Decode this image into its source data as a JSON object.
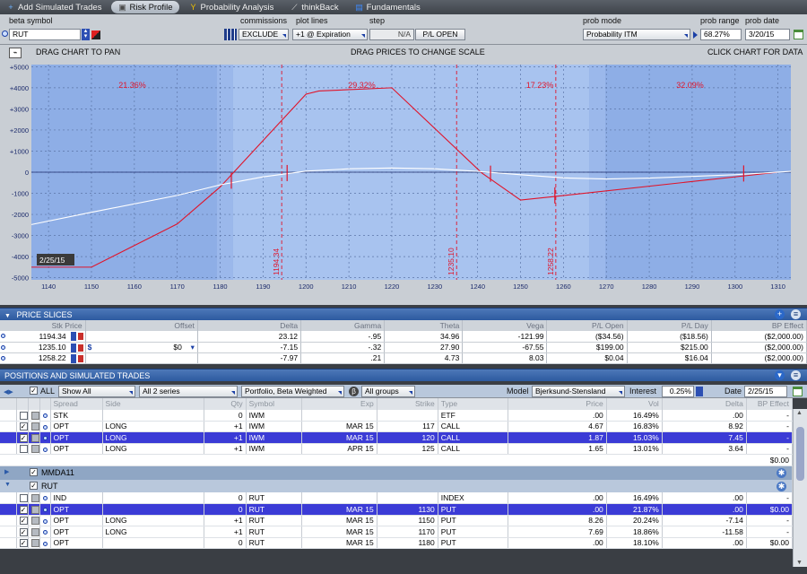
{
  "tabs": [
    {
      "label": "Add Simulated Trades",
      "icon": "plus-icon"
    },
    {
      "label": "Risk Profile",
      "icon": "graph-icon"
    },
    {
      "label": "Probability Analysis",
      "icon": "y-icon"
    },
    {
      "label": "thinkBack",
      "icon": "swoosh-icon"
    },
    {
      "label": "Fundamentals",
      "icon": "folder-icon"
    }
  ],
  "controls": {
    "beta_symbol_label": "beta symbol",
    "symbol": "RUT",
    "commissions_label": "commissions",
    "commissions_value": "EXCLUDE",
    "plot_lines_label": "plot lines",
    "plot_lines_value": "+1 @ Expiration",
    "step_label": "step",
    "step_value": "N/A",
    "pl_mode": "P/L OPEN",
    "prob_mode_label": "prob mode",
    "prob_mode_value": "Probability ITM",
    "prob_range_label": "prob range",
    "prob_range_value": "68.27%",
    "prob_date_label": "prob date",
    "prob_date_value": "3/20/15"
  },
  "chart_hints": {
    "pan": "DRAG CHART TO PAN",
    "scale": "DRAG PRICES TO CHANGE SCALE",
    "data": "CLICK CHART FOR DATA"
  },
  "chart_data": {
    "type": "line",
    "xlim": [
      1136,
      1313
    ],
    "ylim": [
      -5100,
      5100
    ],
    "x_ticks": [
      1140,
      1150,
      1160,
      1170,
      1180,
      1190,
      1200,
      1210,
      1220,
      1230,
      1240,
      1250,
      1260,
      1270,
      1280,
      1290,
      1300,
      1310
    ],
    "y_ticks": [
      -5000,
      -4000,
      -3000,
      -2000,
      -1000,
      0,
      1000,
      2000,
      3000,
      4000,
      5000
    ],
    "y_tick_labels": [
      "-5000",
      "-4000",
      "-3000",
      "-2000",
      "-1000",
      "0",
      "+1000",
      "+2000",
      "+3000",
      "+4000",
      "+5000"
    ],
    "probability_bands": [
      {
        "from": 1136,
        "to": 1183,
        "label": "21.36%"
      },
      {
        "from": 1183,
        "to": 1243,
        "label": "29.32%"
      },
      {
        "from": 1243,
        "to": 1266,
        "label": "17.23%"
      },
      {
        "from": 1266,
        "to": 1313,
        "label": "32.09%"
      }
    ],
    "band_edges": [
      1183,
      1266
    ],
    "vlines": [
      {
        "x": 1194.34,
        "label": "1194.34"
      },
      {
        "x": 1235.1,
        "label": "1235.10"
      },
      {
        "x": 1258.22,
        "label": "1258.22"
      }
    ],
    "series": [
      {
        "name": "expiration",
        "color": "#e0142a",
        "x": [
          1136,
          1150,
          1170,
          1180,
          1200,
          1203,
          1220,
          1241,
          1250,
          1258,
          1310
        ],
        "y": [
          -4500,
          -4500,
          -2450,
          -700,
          3700,
          3850,
          4000,
          -40,
          -1320,
          -1150,
          0
        ]
      },
      {
        "name": "today",
        "color": "#ffffff",
        "x": [
          1136,
          1150,
          1170,
          1180,
          1190,
          1200,
          1210,
          1220,
          1230,
          1240,
          1250,
          1260,
          1270,
          1280,
          1290,
          1300,
          1313
        ],
        "y": [
          -2480,
          -1900,
          -1100,
          -600,
          -220,
          50,
          160,
          200,
          160,
          40,
          -120,
          -270,
          -320,
          -280,
          -200,
          -120,
          40
        ]
      }
    ],
    "date_marker_label": "2/25/15"
  },
  "price_slices": {
    "title": "PRICE SLICES",
    "columns": [
      "Stk Price",
      "Offset",
      "Delta",
      "Gamma",
      "Theta",
      "Vega",
      "P/L Open",
      "P/L Day",
      "BP Effect"
    ],
    "rows": [
      {
        "price": "1194.34",
        "offset": "",
        "delta": "23.12",
        "gamma": "-.95",
        "theta": "34.96",
        "vega": "-121.99",
        "pl_open": "($34.56)",
        "pl_day": "($18.56)",
        "bp": "($2,000.00)"
      },
      {
        "price": "1235.10",
        "offset": "$0",
        "delta": "-7.15",
        "gamma": "-.32",
        "theta": "27.90",
        "vega": "-67.55",
        "pl_open": "$199.00",
        "pl_day": "$215.00",
        "bp": "($2,000.00)"
      },
      {
        "price": "1258.22",
        "offset": "",
        "delta": "-7.97",
        "gamma": ".21",
        "theta": "4.73",
        "vega": "8.03",
        "pl_open": "$0.04",
        "pl_day": "$16.04",
        "bp": "($2,000.00)"
      }
    ]
  },
  "positions": {
    "title": "POSITIONS AND SIMULATED TRADES",
    "all_label": "ALL",
    "show_filter": "Show All",
    "series_filter": "All 2 series",
    "weighting": "Portfolio, Beta Weighted",
    "groups_filter": "All groups",
    "model_label": "Model",
    "model_value": "Bjerksund-Stensland",
    "interest_label": "Interest",
    "interest_value": "0.25%",
    "date_label": "Date",
    "date_value": "2/25/15",
    "columns": [
      "Spread",
      "Side",
      "Qty",
      "Symbol",
      "Exp",
      "Strike",
      "Type",
      "Price",
      "Vol",
      "Delta",
      "BP Effect"
    ],
    "iwm_rows": [
      {
        "spread": "STK",
        "side": "",
        "qty": "0",
        "symbol": "IWM",
        "exp": "",
        "strike": "",
        "type": "ETF",
        "price": ".00",
        "vol": "16.49%",
        "delta": ".00",
        "bp": "-",
        "checked": false,
        "selected": false
      },
      {
        "spread": "OPT",
        "side": "LONG",
        "qty": "+1",
        "symbol": "IWM",
        "exp": "MAR 15",
        "strike": "117",
        "type": "CALL",
        "price": "4.67",
        "vol": "16.83%",
        "delta": "8.92",
        "bp": "-",
        "checked": true,
        "selected": false
      },
      {
        "spread": "OPT",
        "side": "LONG",
        "qty": "+1",
        "symbol": "IWM",
        "exp": "MAR 15",
        "strike": "120",
        "type": "CALL",
        "price": "1.87",
        "vol": "15.03%",
        "delta": "7.45",
        "bp": "-",
        "checked": true,
        "selected": true
      },
      {
        "spread": "OPT",
        "side": "LONG",
        "qty": "+1",
        "symbol": "IWM",
        "exp": "APR 15",
        "strike": "125",
        "type": "CALL",
        "price": "1.65",
        "vol": "13.01%",
        "delta": "3.64",
        "bp": "-",
        "checked": false,
        "selected": false
      }
    ],
    "iwm_total": "$0.00",
    "group_mmda": "MMDA11",
    "group_rut": "RUT",
    "rut_rows": [
      {
        "spread": "IND",
        "side": "",
        "qty": "0",
        "symbol": "RUT",
        "exp": "",
        "strike": "",
        "type": "INDEX",
        "price": ".00",
        "vol": "16.49%",
        "delta": ".00",
        "bp": "-",
        "checked": false,
        "selected": false
      },
      {
        "spread": "OPT",
        "side": "",
        "qty": "0",
        "symbol": "RUT",
        "exp": "MAR 15",
        "strike": "1130",
        "type": "PUT",
        "price": ".00",
        "vol": "21.87%",
        "delta": ".00",
        "bp": "$0.00",
        "checked": true,
        "selected": true
      },
      {
        "spread": "OPT",
        "side": "LONG",
        "qty": "+1",
        "symbol": "RUT",
        "exp": "MAR 15",
        "strike": "1150",
        "type": "PUT",
        "price": "8.26",
        "vol": "20.24%",
        "delta": "-7.14",
        "bp": "-",
        "checked": true,
        "selected": false
      },
      {
        "spread": "OPT",
        "side": "LONG",
        "qty": "+1",
        "symbol": "RUT",
        "exp": "MAR 15",
        "strike": "1170",
        "type": "PUT",
        "price": "7.69",
        "vol": "18.86%",
        "delta": "-11.58",
        "bp": "-",
        "checked": true,
        "selected": false
      },
      {
        "spread": "OPT",
        "side": "",
        "qty": "0",
        "symbol": "RUT",
        "exp": "MAR 15",
        "strike": "1180",
        "type": "PUT",
        "price": ".00",
        "vol": "18.10%",
        "delta": ".00",
        "bp": "$0.00",
        "checked": true,
        "selected": false
      }
    ]
  }
}
